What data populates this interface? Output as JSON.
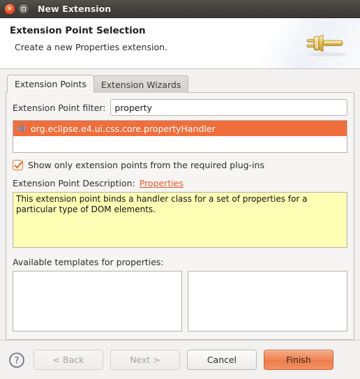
{
  "window": {
    "title": "New Extension",
    "close_label": "×",
    "maximize_label": ""
  },
  "banner": {
    "title": "Extension Point Selection",
    "subtitle": "Create a new Properties extension.",
    "icon": "plug-icon"
  },
  "tabs": [
    {
      "label": "Extension Points",
      "active": true
    },
    {
      "label": "Extension Wizards",
      "active": false
    }
  ],
  "filter": {
    "label": "Extension Point filter:",
    "value": "property",
    "placeholder": ""
  },
  "extension_points": [
    {
      "label": "org.eclipse.e4.ui.css.core.propertyHandler",
      "icon": "extension-point-icon",
      "selected": true
    }
  ],
  "checkbox": {
    "label": "Show only extension points from the required plug-ins",
    "checked": true
  },
  "description": {
    "label": "Extension Point Description:",
    "link": "Properties",
    "text": "This extension point binds a handler class for a set of properties for a particular type of DOM elements."
  },
  "templates": {
    "label": "Available templates for properties:",
    "left_items": [],
    "right_items": []
  },
  "buttons": {
    "help": "?",
    "back": "< Back",
    "next": "Next >",
    "cancel": "Cancel",
    "finish": "Finish"
  },
  "colors": {
    "selection": "#ef6e3c",
    "link": "#e8552b",
    "description_background": "#feffb5",
    "primary_button": "#ef8252",
    "titlebar": "#433f3b"
  }
}
